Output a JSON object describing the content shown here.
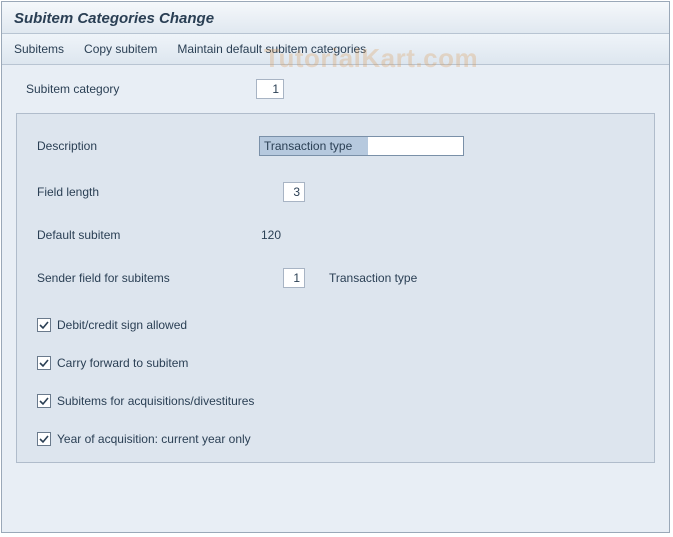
{
  "title": "Subitem Categories Change",
  "toolbar": {
    "subitems": "Subitems",
    "copy_subitem": "Copy subitem",
    "maintain_default": "Maintain default subitem categories"
  },
  "watermark": "TutorialKart.com",
  "top": {
    "subitem_category_label": "Subitem category",
    "subitem_category_value": "1"
  },
  "group": {
    "description_label": "Description",
    "description_value": "Transaction type",
    "field_length_label": "Field length",
    "field_length_value": "3",
    "default_subitem_label": "Default subitem",
    "default_subitem_value": "120",
    "sender_field_label": "Sender field for subitems",
    "sender_field_value": "1",
    "sender_field_text": "Transaction type"
  },
  "checks": {
    "debit_credit": "Debit/credit sign allowed",
    "carry_forward": "Carry forward to subitem",
    "acquisitions": "Subitems for acquisitions/divestitures",
    "year_acq": "Year of acquisition: current year only"
  }
}
